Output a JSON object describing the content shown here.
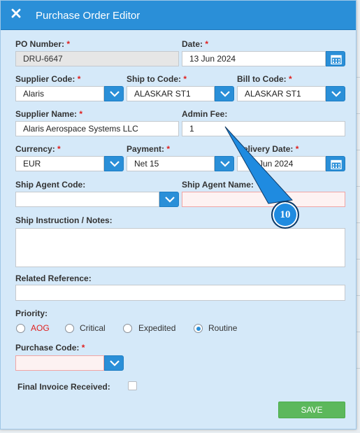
{
  "window": {
    "title": "Purchase Order Editor",
    "close_icon": "close-icon"
  },
  "po_number": {
    "label": "PO Number:",
    "required": "*",
    "value": "DRU-6647"
  },
  "date": {
    "label": "Date:",
    "required": "*",
    "value": "13 Jun 2024"
  },
  "supplier_code": {
    "label": "Supplier Code:",
    "required": "*",
    "value": "Alaris"
  },
  "ship_to_code": {
    "label": "Ship to Code:",
    "required": "*",
    "value": "ALASKAR ST1"
  },
  "bill_to_code": {
    "label": "Bill to Code:",
    "required": "*",
    "value": "ALASKAR ST1"
  },
  "supplier_name": {
    "label": "Supplier Name:",
    "required": "*",
    "value": "Alaris Aerospace Systems LLC"
  },
  "admin_fee": {
    "label": "Admin Fee:",
    "value": "1"
  },
  "currency": {
    "label": "Currency:",
    "required": "*",
    "value": "EUR"
  },
  "payment": {
    "label": "Payment:",
    "required": "*",
    "value": "Net 15"
  },
  "delivery_date": {
    "label": "elivery Date:",
    "required": "*",
    "value": "Jun 2024"
  },
  "ship_agent_code": {
    "label": "Ship Agent Code:",
    "value": ""
  },
  "ship_agent_name": {
    "label": "Ship Agent Name:",
    "value": ""
  },
  "ship_instruction": {
    "label": "Ship Instruction / Notes:",
    "value": ""
  },
  "related_reference": {
    "label": "Related Reference:",
    "value": ""
  },
  "priority": {
    "label": "Priority:",
    "options": [
      "AOG",
      "Critical",
      "Expedited",
      "Routine"
    ],
    "selected": "Routine",
    "aog_color": "#e0201f"
  },
  "purchase_code": {
    "label": "Purchase Code:",
    "required": "*",
    "value": ""
  },
  "final_invoice": {
    "label": "Final Invoice Received:",
    "checked": false
  },
  "save_label": "SAVE",
  "callout": {
    "number": "10"
  },
  "colors": {
    "accent": "#2a8fd8",
    "save": "#5cb85c",
    "panel": "#d5e9f9"
  }
}
